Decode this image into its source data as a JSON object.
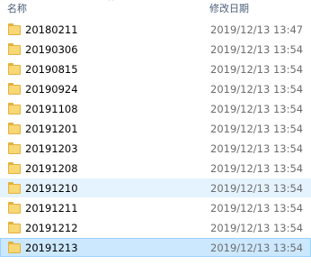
{
  "header": {
    "name_label": "名称",
    "date_label": "修改日期",
    "sort_indicator": "^"
  },
  "colors": {
    "hover_background": "#e5f3ff",
    "selected_background": "#cce8ff",
    "selected_border": "#99d1ff",
    "folder_yellow": "#f8d775"
  },
  "folders": [
    {
      "name": "20180211",
      "date": "2019/12/13 13:47",
      "state": "normal"
    },
    {
      "name": "20190306",
      "date": "2019/12/13 13:54",
      "state": "normal"
    },
    {
      "name": "20190815",
      "date": "2019/12/13 13:54",
      "state": "normal"
    },
    {
      "name": "20190924",
      "date": "2019/12/13 13:54",
      "state": "normal"
    },
    {
      "name": "20191108",
      "date": "2019/12/13 13:54",
      "state": "normal"
    },
    {
      "name": "20191201",
      "date": "2019/12/13 13:54",
      "state": "normal"
    },
    {
      "name": "20191203",
      "date": "2019/12/13 13:54",
      "state": "normal"
    },
    {
      "name": "20191208",
      "date": "2019/12/13 13:54",
      "state": "normal"
    },
    {
      "name": "20191210",
      "date": "2019/12/13 13:54",
      "state": "hover"
    },
    {
      "name": "20191211",
      "date": "2019/12/13 13:54",
      "state": "normal"
    },
    {
      "name": "20191212",
      "date": "2019/12/13 13:54",
      "state": "normal"
    },
    {
      "name": "20191213",
      "date": "2019/12/13 13:54",
      "state": "selected"
    }
  ]
}
